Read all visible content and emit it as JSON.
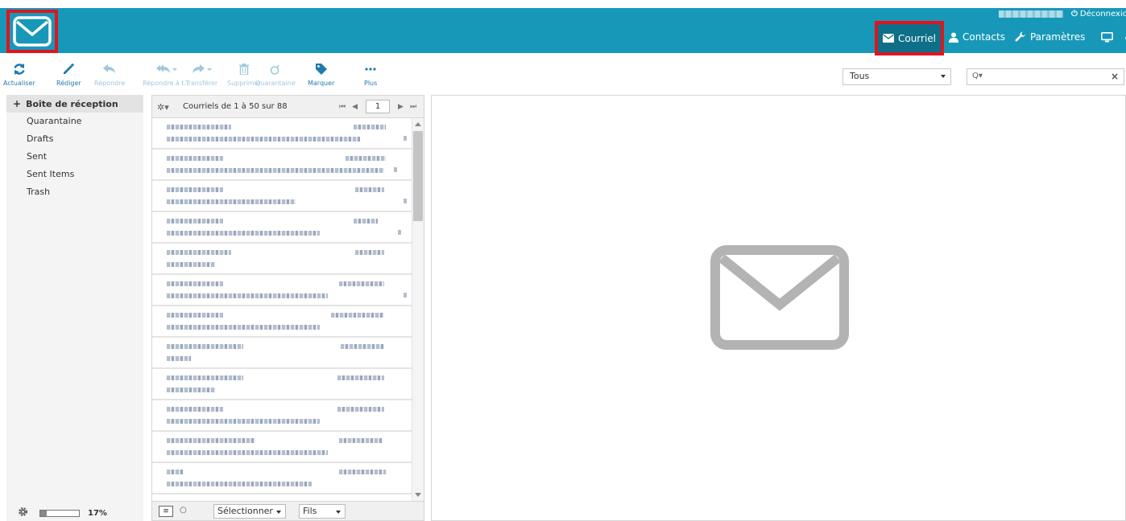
{
  "header": {
    "user_name": "",
    "logout_label": "Déconnexion",
    "nav": {
      "mail": "Courriel",
      "contacts": "Contacts",
      "settings": "Paramètres"
    },
    "accent_color": "#1798b8",
    "highlight_color": "#e0141e"
  },
  "toolbar": {
    "refresh": "Actualiser",
    "compose": "Rédiger",
    "reply": "Répondre",
    "reply_all": "Répondre à t...",
    "forward": "Transférer",
    "delete": "Supprimer",
    "quarantine": "Quarantaine",
    "mark": "Marquer",
    "more": "Plus"
  },
  "filter": {
    "selected": "Tous"
  },
  "search": {
    "placeholder": ""
  },
  "folders": {
    "items": [
      {
        "label": "Boîte de réception"
      },
      {
        "label": "Quarantaine"
      },
      {
        "label": "Drafts"
      },
      {
        "label": "Sent"
      },
      {
        "label": "Sent Items"
      },
      {
        "label": "Trash"
      }
    ],
    "quota_percent": 17,
    "quota_label": "17%"
  },
  "message_list": {
    "count_label": "Courriels de 1 à 50 sur 88",
    "page": "1",
    "footer": {
      "select_label": "Sélectionner",
      "threads_label": "Fils"
    }
  }
}
